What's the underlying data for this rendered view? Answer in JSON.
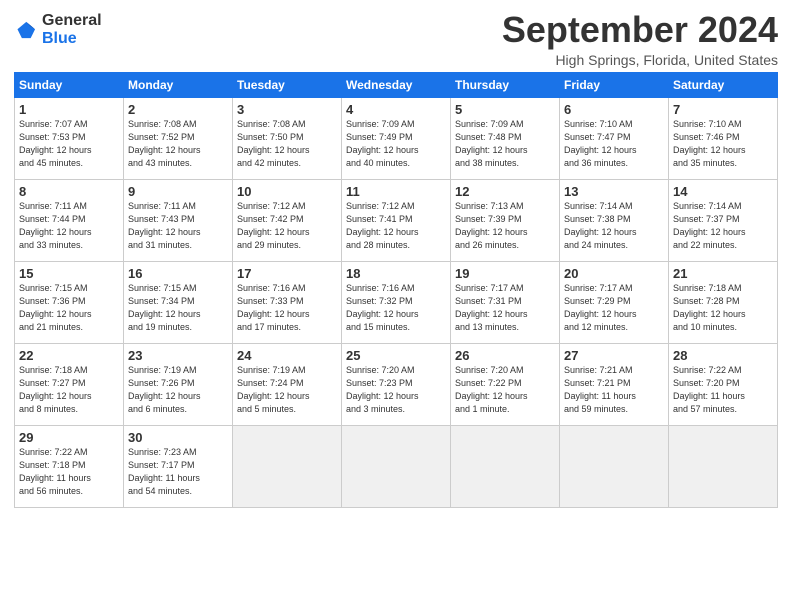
{
  "header": {
    "logo_line1": "General",
    "logo_line2": "Blue",
    "month": "September 2024",
    "location": "High Springs, Florida, United States"
  },
  "weekdays": [
    "Sunday",
    "Monday",
    "Tuesday",
    "Wednesday",
    "Thursday",
    "Friday",
    "Saturday"
  ],
  "weeks": [
    [
      {
        "day": "1",
        "info": "Sunrise: 7:07 AM\nSunset: 7:53 PM\nDaylight: 12 hours\nand 45 minutes."
      },
      {
        "day": "2",
        "info": "Sunrise: 7:08 AM\nSunset: 7:52 PM\nDaylight: 12 hours\nand 43 minutes."
      },
      {
        "day": "3",
        "info": "Sunrise: 7:08 AM\nSunset: 7:50 PM\nDaylight: 12 hours\nand 42 minutes."
      },
      {
        "day": "4",
        "info": "Sunrise: 7:09 AM\nSunset: 7:49 PM\nDaylight: 12 hours\nand 40 minutes."
      },
      {
        "day": "5",
        "info": "Sunrise: 7:09 AM\nSunset: 7:48 PM\nDaylight: 12 hours\nand 38 minutes."
      },
      {
        "day": "6",
        "info": "Sunrise: 7:10 AM\nSunset: 7:47 PM\nDaylight: 12 hours\nand 36 minutes."
      },
      {
        "day": "7",
        "info": "Sunrise: 7:10 AM\nSunset: 7:46 PM\nDaylight: 12 hours\nand 35 minutes."
      }
    ],
    [
      {
        "day": "8",
        "info": "Sunrise: 7:11 AM\nSunset: 7:44 PM\nDaylight: 12 hours\nand 33 minutes."
      },
      {
        "day": "9",
        "info": "Sunrise: 7:11 AM\nSunset: 7:43 PM\nDaylight: 12 hours\nand 31 minutes."
      },
      {
        "day": "10",
        "info": "Sunrise: 7:12 AM\nSunset: 7:42 PM\nDaylight: 12 hours\nand 29 minutes."
      },
      {
        "day": "11",
        "info": "Sunrise: 7:12 AM\nSunset: 7:41 PM\nDaylight: 12 hours\nand 28 minutes."
      },
      {
        "day": "12",
        "info": "Sunrise: 7:13 AM\nSunset: 7:39 PM\nDaylight: 12 hours\nand 26 minutes."
      },
      {
        "day": "13",
        "info": "Sunrise: 7:14 AM\nSunset: 7:38 PM\nDaylight: 12 hours\nand 24 minutes."
      },
      {
        "day": "14",
        "info": "Sunrise: 7:14 AM\nSunset: 7:37 PM\nDaylight: 12 hours\nand 22 minutes."
      }
    ],
    [
      {
        "day": "15",
        "info": "Sunrise: 7:15 AM\nSunset: 7:36 PM\nDaylight: 12 hours\nand 21 minutes."
      },
      {
        "day": "16",
        "info": "Sunrise: 7:15 AM\nSunset: 7:34 PM\nDaylight: 12 hours\nand 19 minutes."
      },
      {
        "day": "17",
        "info": "Sunrise: 7:16 AM\nSunset: 7:33 PM\nDaylight: 12 hours\nand 17 minutes."
      },
      {
        "day": "18",
        "info": "Sunrise: 7:16 AM\nSunset: 7:32 PM\nDaylight: 12 hours\nand 15 minutes."
      },
      {
        "day": "19",
        "info": "Sunrise: 7:17 AM\nSunset: 7:31 PM\nDaylight: 12 hours\nand 13 minutes."
      },
      {
        "day": "20",
        "info": "Sunrise: 7:17 AM\nSunset: 7:29 PM\nDaylight: 12 hours\nand 12 minutes."
      },
      {
        "day": "21",
        "info": "Sunrise: 7:18 AM\nSunset: 7:28 PM\nDaylight: 12 hours\nand 10 minutes."
      }
    ],
    [
      {
        "day": "22",
        "info": "Sunrise: 7:18 AM\nSunset: 7:27 PM\nDaylight: 12 hours\nand 8 minutes."
      },
      {
        "day": "23",
        "info": "Sunrise: 7:19 AM\nSunset: 7:26 PM\nDaylight: 12 hours\nand 6 minutes."
      },
      {
        "day": "24",
        "info": "Sunrise: 7:19 AM\nSunset: 7:24 PM\nDaylight: 12 hours\nand 5 minutes."
      },
      {
        "day": "25",
        "info": "Sunrise: 7:20 AM\nSunset: 7:23 PM\nDaylight: 12 hours\nand 3 minutes."
      },
      {
        "day": "26",
        "info": "Sunrise: 7:20 AM\nSunset: 7:22 PM\nDaylight: 12 hours\nand 1 minute."
      },
      {
        "day": "27",
        "info": "Sunrise: 7:21 AM\nSunset: 7:21 PM\nDaylight: 11 hours\nand 59 minutes."
      },
      {
        "day": "28",
        "info": "Sunrise: 7:22 AM\nSunset: 7:20 PM\nDaylight: 11 hours\nand 57 minutes."
      }
    ],
    [
      {
        "day": "29",
        "info": "Sunrise: 7:22 AM\nSunset: 7:18 PM\nDaylight: 11 hours\nand 56 minutes."
      },
      {
        "day": "30",
        "info": "Sunrise: 7:23 AM\nSunset: 7:17 PM\nDaylight: 11 hours\nand 54 minutes."
      },
      {
        "day": "",
        "info": ""
      },
      {
        "day": "",
        "info": ""
      },
      {
        "day": "",
        "info": ""
      },
      {
        "day": "",
        "info": ""
      },
      {
        "day": "",
        "info": ""
      }
    ]
  ]
}
